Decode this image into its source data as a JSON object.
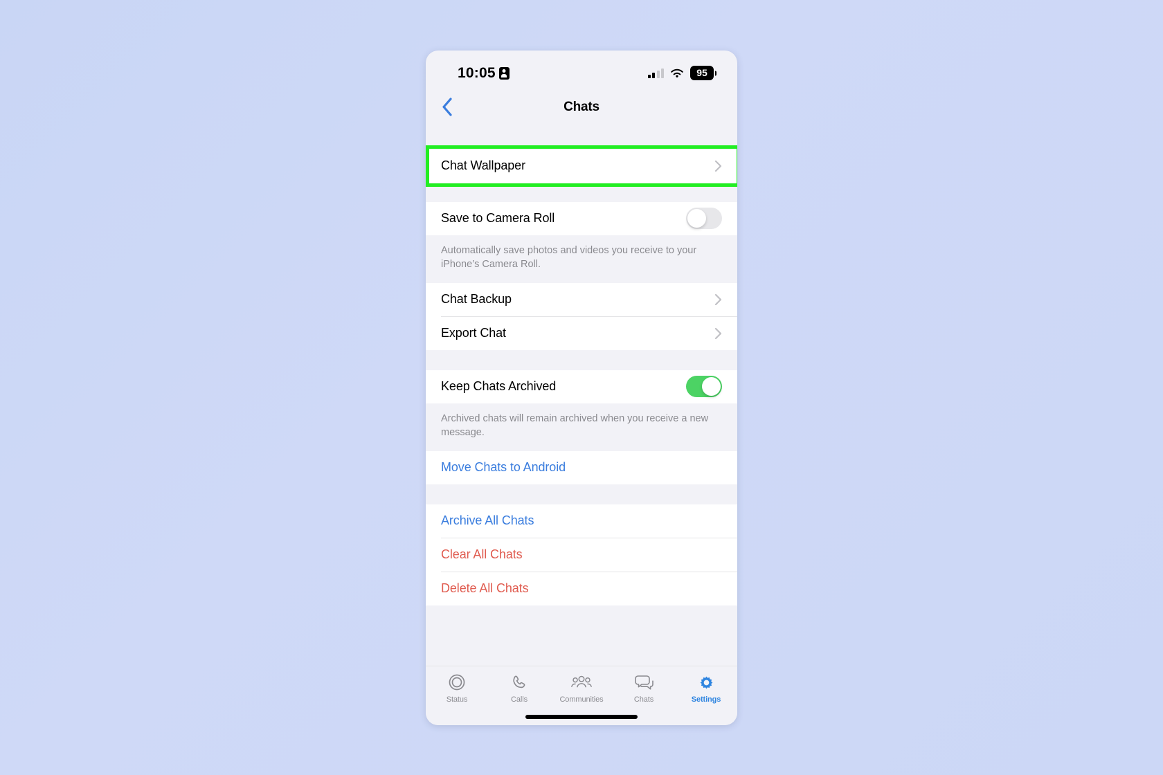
{
  "status_bar": {
    "time": "10:05",
    "recording_icon": "screen-record-icon",
    "cellular_icon": "cellular-signal-icon",
    "wifi_icon": "wifi-icon",
    "battery_percent": "95"
  },
  "nav": {
    "back_icon": "chevron-left-icon",
    "title": "Chats"
  },
  "highlight": {
    "color": "#22ee22",
    "target": "Chat Wallpaper"
  },
  "sections": {
    "wallpaper": {
      "label": "Chat Wallpaper",
      "accessory": "chevron-right-icon"
    },
    "camera_roll": {
      "label": "Save to Camera Roll",
      "toggle_state": "off",
      "note": "Automatically save photos and videos you receive to your iPhone’s Camera Roll."
    },
    "backup": {
      "items": [
        {
          "label": "Chat Backup",
          "accessory": "chevron-right-icon"
        },
        {
          "label": "Export Chat",
          "accessory": "chevron-right-icon"
        }
      ]
    },
    "archive": {
      "label": "Keep Chats Archived",
      "toggle_state": "on",
      "note": "Archived chats will remain archived when you receive a new message."
    },
    "move": {
      "label": "Move Chats to Android"
    },
    "actions": {
      "items": [
        {
          "label": "Archive All Chats",
          "style": "link"
        },
        {
          "label": "Clear All Chats",
          "style": "danger"
        },
        {
          "label": "Delete All Chats",
          "style": "danger"
        }
      ]
    }
  },
  "tabbar": {
    "items": [
      {
        "label": "Status",
        "icon": "status-rings-icon",
        "active": false
      },
      {
        "label": "Calls",
        "icon": "phone-icon",
        "active": false
      },
      {
        "label": "Communities",
        "icon": "communities-people-icon",
        "active": false
      },
      {
        "label": "Chats",
        "icon": "chat-bubbles-icon",
        "active": false
      },
      {
        "label": "Settings",
        "icon": "gear-icon",
        "active": true
      }
    ]
  },
  "colors": {
    "link": "#3a7dde",
    "danger": "#e05c50",
    "toggle_on": "#4cd364",
    "active_tab": "#2f85e0"
  }
}
